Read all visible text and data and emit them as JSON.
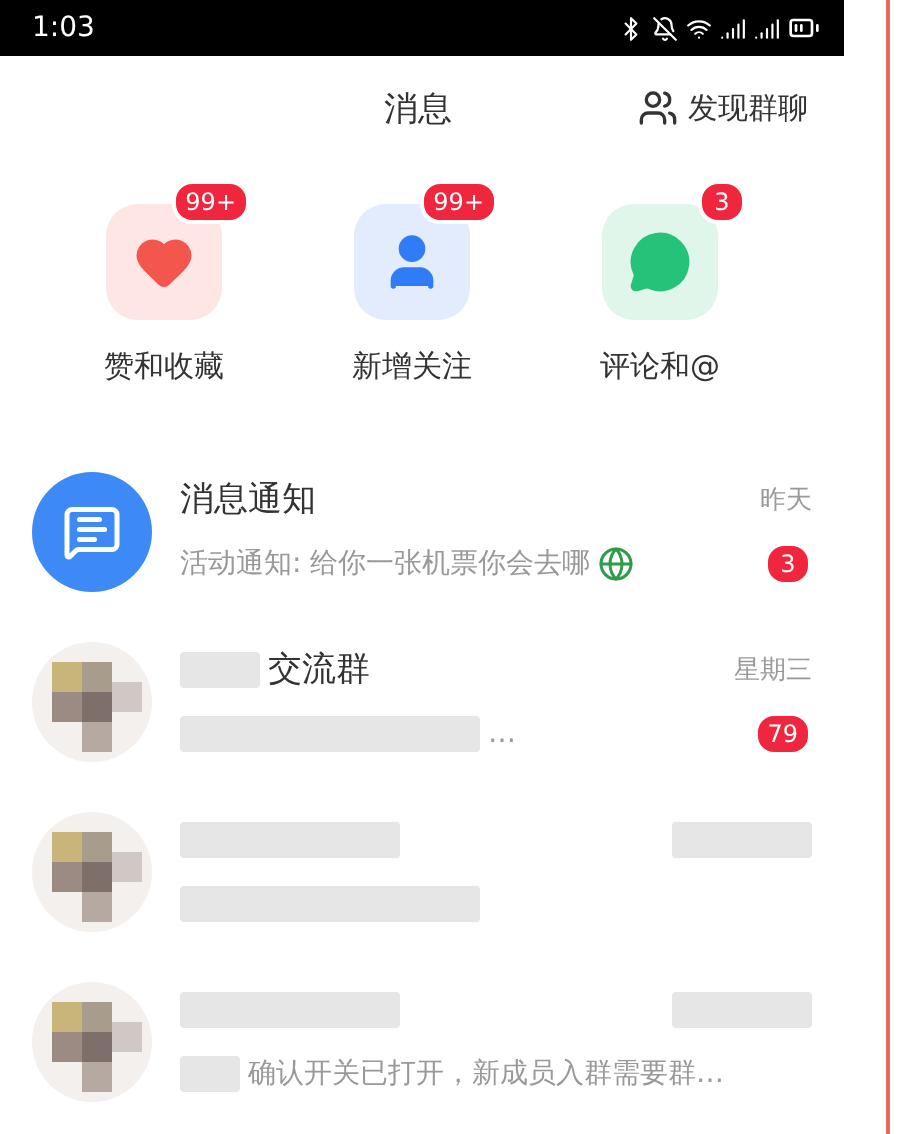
{
  "status_bar": {
    "time": "1:03"
  },
  "header": {
    "title": "消息",
    "action": "发现群聊"
  },
  "shortcuts": [
    {
      "kind": "likes",
      "label": "赞和收藏",
      "badge": "99+"
    },
    {
      "kind": "follows",
      "label": "新增关注",
      "badge": "99+"
    },
    {
      "kind": "comments",
      "label": "评论和@",
      "badge": "3"
    }
  ],
  "conversations": [
    {
      "kind": "system",
      "name": "消息通知",
      "time": "昨天",
      "preview": "活动通知: 给你一张机票你会去哪",
      "badge": "3"
    },
    {
      "kind": "redacted",
      "name": "交流群",
      "time": "星期三",
      "preview": "…",
      "badge": "79"
    },
    {
      "kind": "redacted"
    },
    {
      "kind": "redacted",
      "preview": "确认开关已打开，新成员入群需要群…"
    }
  ]
}
